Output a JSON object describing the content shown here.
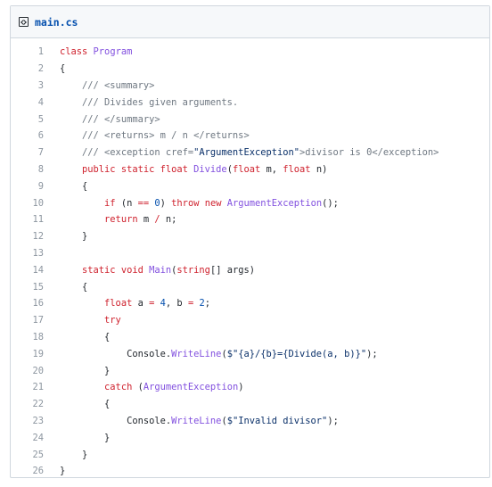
{
  "file": {
    "icon": "code-file-icon",
    "name": "main.cs"
  },
  "lines": [
    {
      "n": "1",
      "t": [
        [
          "kw",
          "class "
        ],
        [
          "fn",
          "Program"
        ]
      ]
    },
    {
      "n": "2",
      "t": [
        [
          "",
          "{"
        ]
      ]
    },
    {
      "n": "3",
      "t": [
        [
          "cm",
          "    /// <summary>"
        ]
      ]
    },
    {
      "n": "4",
      "t": [
        [
          "cm",
          "    /// Divides given arguments."
        ]
      ]
    },
    {
      "n": "5",
      "t": [
        [
          "cm",
          "    /// </summary>"
        ]
      ]
    },
    {
      "n": "6",
      "t": [
        [
          "cm",
          "    /// <returns> m / n </returns>"
        ]
      ]
    },
    {
      "n": "7",
      "t": [
        [
          "cm",
          "    /// <exception cref="
        ],
        [
          "st",
          "\"ArgumentException\""
        ],
        [
          "cm",
          ">divisor is 0</exception>"
        ]
      ]
    },
    {
      "n": "8",
      "t": [
        [
          "kw",
          "    public static float "
        ],
        [
          "fn",
          "Divide"
        ],
        [
          "",
          "("
        ],
        [
          "kw",
          "float "
        ],
        [
          "",
          "m, "
        ],
        [
          "kw",
          "float "
        ],
        [
          "",
          "n)"
        ]
      ]
    },
    {
      "n": "9",
      "t": [
        [
          "",
          "    {"
        ]
      ]
    },
    {
      "n": "10",
      "t": [
        [
          "kw",
          "        if "
        ],
        [
          "",
          "(n "
        ],
        [
          "kw",
          "=="
        ],
        [
          "",
          " "
        ],
        [
          "nu",
          "0"
        ],
        [
          "",
          ") "
        ],
        [
          "kw",
          "throw new "
        ],
        [
          "fn",
          "ArgumentException"
        ],
        [
          "",
          "();"
        ]
      ]
    },
    {
      "n": "11",
      "t": [
        [
          "kw",
          "        return "
        ],
        [
          "",
          "m "
        ],
        [
          "kw",
          "/"
        ],
        [
          "",
          " n;"
        ]
      ]
    },
    {
      "n": "12",
      "t": [
        [
          "",
          "    }"
        ]
      ]
    },
    {
      "n": "13",
      "t": [
        [
          "",
          ""
        ]
      ]
    },
    {
      "n": "14",
      "t": [
        [
          "kw",
          "    static void "
        ],
        [
          "fn",
          "Main"
        ],
        [
          "",
          "("
        ],
        [
          "kw",
          "string"
        ],
        [
          "",
          "[] args)"
        ]
      ]
    },
    {
      "n": "15",
      "t": [
        [
          "",
          "    {"
        ]
      ]
    },
    {
      "n": "16",
      "t": [
        [
          "kw",
          "        float "
        ],
        [
          "",
          "a "
        ],
        [
          "kw",
          "="
        ],
        [
          "",
          " "
        ],
        [
          "nu",
          "4"
        ],
        [
          "",
          ", b "
        ],
        [
          "kw",
          "="
        ],
        [
          "",
          " "
        ],
        [
          "nu",
          "2"
        ],
        [
          "",
          ";"
        ]
      ]
    },
    {
      "n": "17",
      "t": [
        [
          "kw",
          "        try"
        ]
      ]
    },
    {
      "n": "18",
      "t": [
        [
          "",
          "        {"
        ]
      ]
    },
    {
      "n": "19",
      "t": [
        [
          "",
          "            Console."
        ],
        [
          "fn",
          "WriteLine"
        ],
        [
          "",
          "("
        ],
        [
          "st",
          "$\"{a}/{b}={Divide(a, b)}\""
        ],
        [
          "",
          ");"
        ]
      ]
    },
    {
      "n": "20",
      "t": [
        [
          "",
          "        }"
        ]
      ]
    },
    {
      "n": "21",
      "t": [
        [
          "kw",
          "        catch "
        ],
        [
          "",
          "("
        ],
        [
          "fn",
          "ArgumentException"
        ],
        [
          "",
          ")"
        ]
      ]
    },
    {
      "n": "22",
      "t": [
        [
          "",
          "        {"
        ]
      ]
    },
    {
      "n": "23",
      "t": [
        [
          "",
          "            Console."
        ],
        [
          "fn",
          "WriteLine"
        ],
        [
          "",
          "("
        ],
        [
          "st",
          "$\"Invalid divisor\""
        ],
        [
          "",
          ");"
        ]
      ]
    },
    {
      "n": "24",
      "t": [
        [
          "",
          "        }"
        ]
      ]
    },
    {
      "n": "25",
      "t": [
        [
          "",
          "    }"
        ]
      ]
    },
    {
      "n": "26",
      "t": [
        [
          "",
          "}"
        ]
      ]
    }
  ]
}
